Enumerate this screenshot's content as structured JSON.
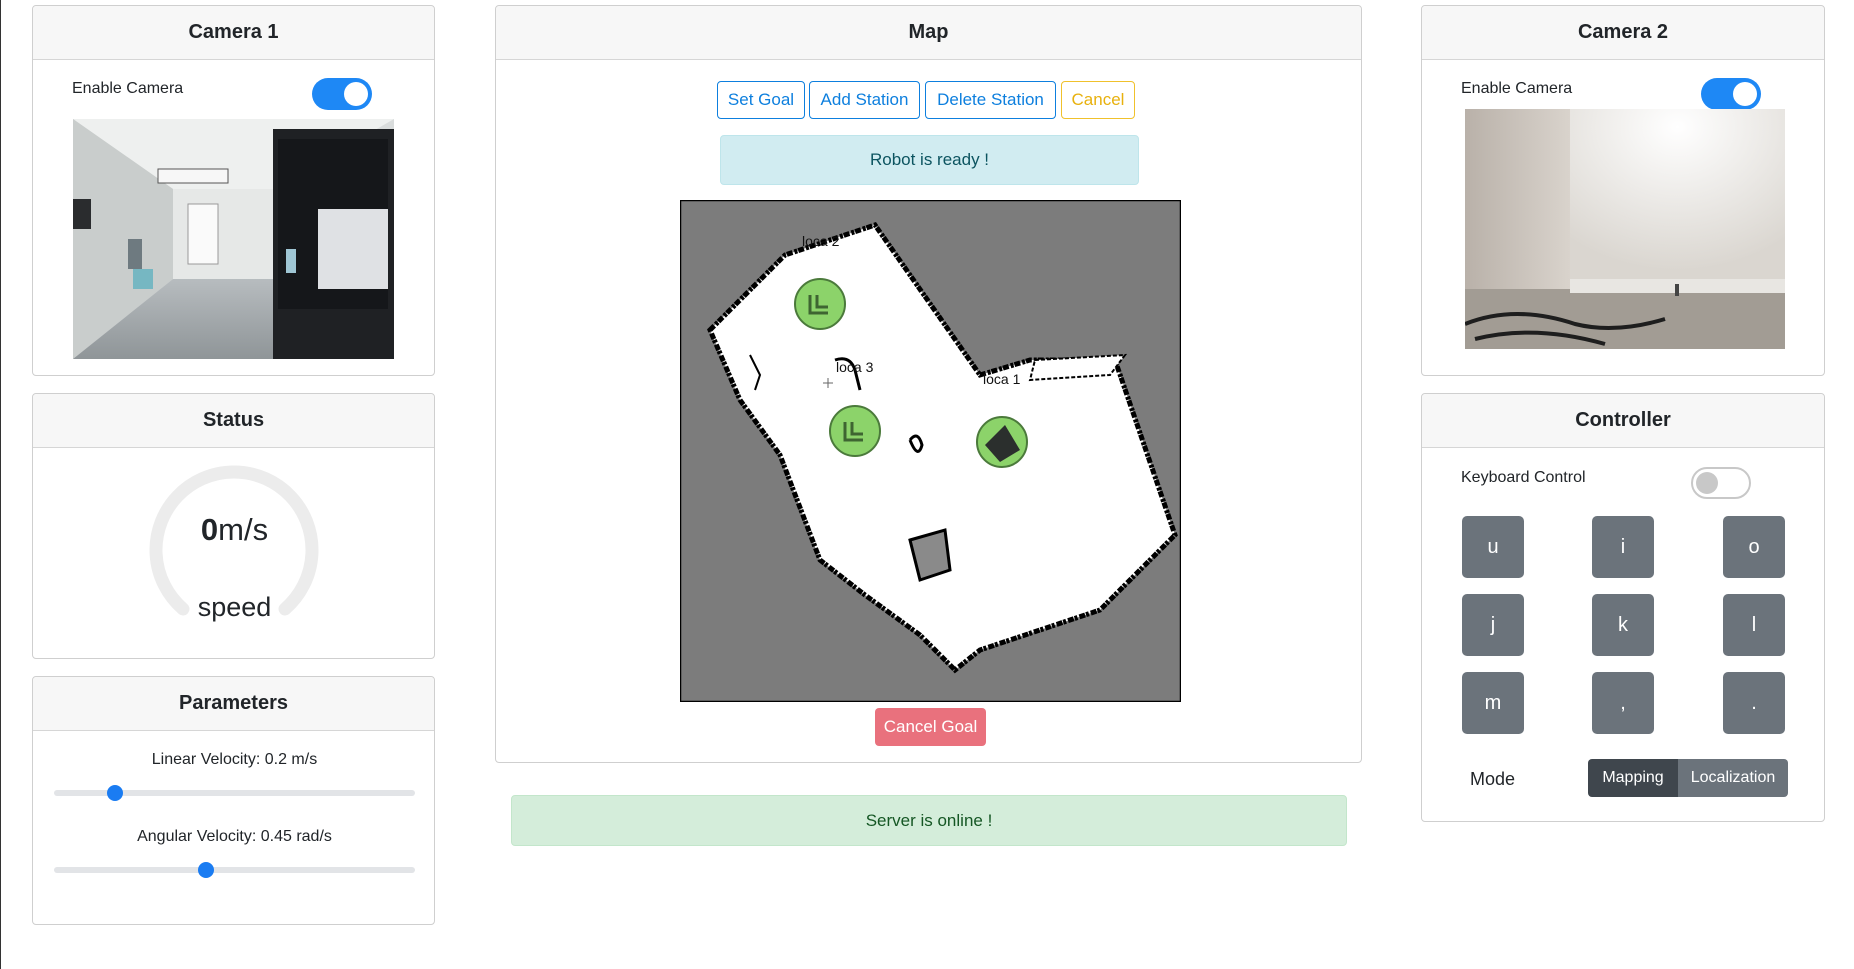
{
  "camera1": {
    "title": "Camera 1",
    "enable_label": "Enable Camera",
    "enabled": true
  },
  "camera2": {
    "title": "Camera 2",
    "enable_label": "Enable Camera",
    "enabled": true
  },
  "status": {
    "title": "Status",
    "speed_value": "0",
    "speed_unit": "m/s",
    "speed_label": "speed"
  },
  "parameters": {
    "title": "Parameters",
    "linear_label": "Linear Velocity: 0.2 m/s",
    "linear_fraction": 0.17,
    "angular_label": "Angular Velocity: 0.45 rad/s",
    "angular_fraction": 0.42
  },
  "map": {
    "title": "Map",
    "buttons": {
      "set_goal": "Set Goal",
      "add_station": "Add Station",
      "delete_station": "Delete Station",
      "cancel": "Cancel"
    },
    "robot_status": "Robot is ready !",
    "stations": [
      "loca 2",
      "loca 3",
      "loca 1"
    ],
    "cancel_goal": "Cancel Goal"
  },
  "server_status": "Server is online !",
  "controller": {
    "title": "Controller",
    "keyboard_label": "Keyboard Control",
    "keyboard_enabled": false,
    "keys": [
      "u",
      "i",
      "o",
      "j",
      "k",
      "l",
      "m",
      ",",
      "."
    ],
    "mode_label": "Mode",
    "mode_options": [
      "Mapping",
      "Localization"
    ],
    "mode_selected": "Mapping"
  },
  "colors": {
    "accent": "#1e88f5",
    "info_bg": "#d1ecf1",
    "success_bg": "#d4edda",
    "danger": "#e9717d",
    "warning": "#f0c12c"
  }
}
